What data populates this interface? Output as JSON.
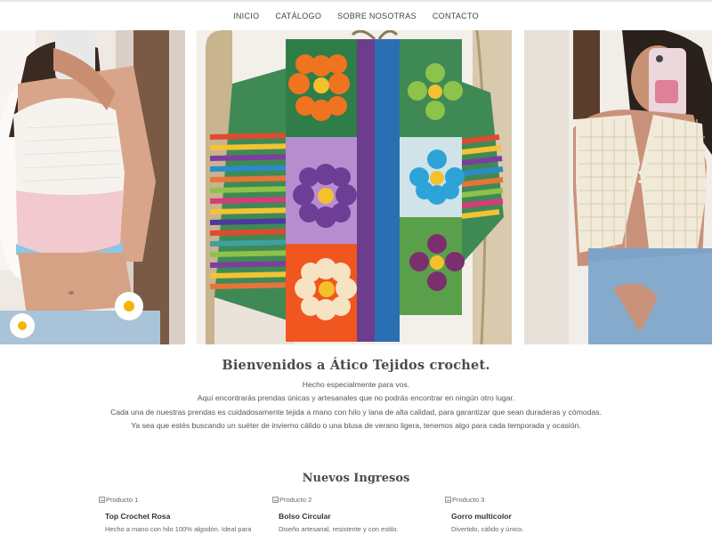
{
  "nav": {
    "items": [
      {
        "label": "INICIO"
      },
      {
        "label": "CATÁLOGO"
      },
      {
        "label": "SOBRE NOSOTRAS"
      },
      {
        "label": "CONTACTO"
      }
    ]
  },
  "hero": {
    "images": [
      {
        "alt": "Top crochet blanco y rosa"
      },
      {
        "alt": "Cárdigan crochet multicolor con flores"
      },
      {
        "alt": "Chaleco crochet crema"
      }
    ]
  },
  "welcome": {
    "title": "Bienvenidos a Ático Tejidos crochet.",
    "lines": [
      "Hecho especialmente para vos.",
      "Aquí encontrarás prendas únicas y artesanales que no podrás encontrar en ningún otro lugar.",
      "Cada una de nuestras prendas es cuidadosamente tejida a mano con hilo y lana de alta calidad, para garantizar que sean duraderas y cómodas.",
      "Ya sea que estés buscando un suéter de invierno cálido o una blusa de verano ligera, tenemos algo para cada temporada y ocasión."
    ]
  },
  "new_in": {
    "title": "Nuevos Ingresos"
  },
  "products": [
    {
      "alt": "Producto 1",
      "title": "Top Crochet Rosa",
      "desc": "Hecho a mano con hilo 100% algodón. Ideal para"
    },
    {
      "alt": "Producto 2",
      "title": "Bolso Circular",
      "desc": "Diseño artesanal, resistente y con estilo."
    },
    {
      "alt": "Producto 3",
      "title": "Gorro multicolor",
      "desc": "Divertido, cálido y único."
    }
  ],
  "colors": {
    "text": "#4a4a4a",
    "nav_border": "#e6e6e6",
    "background": "#ffffff"
  }
}
